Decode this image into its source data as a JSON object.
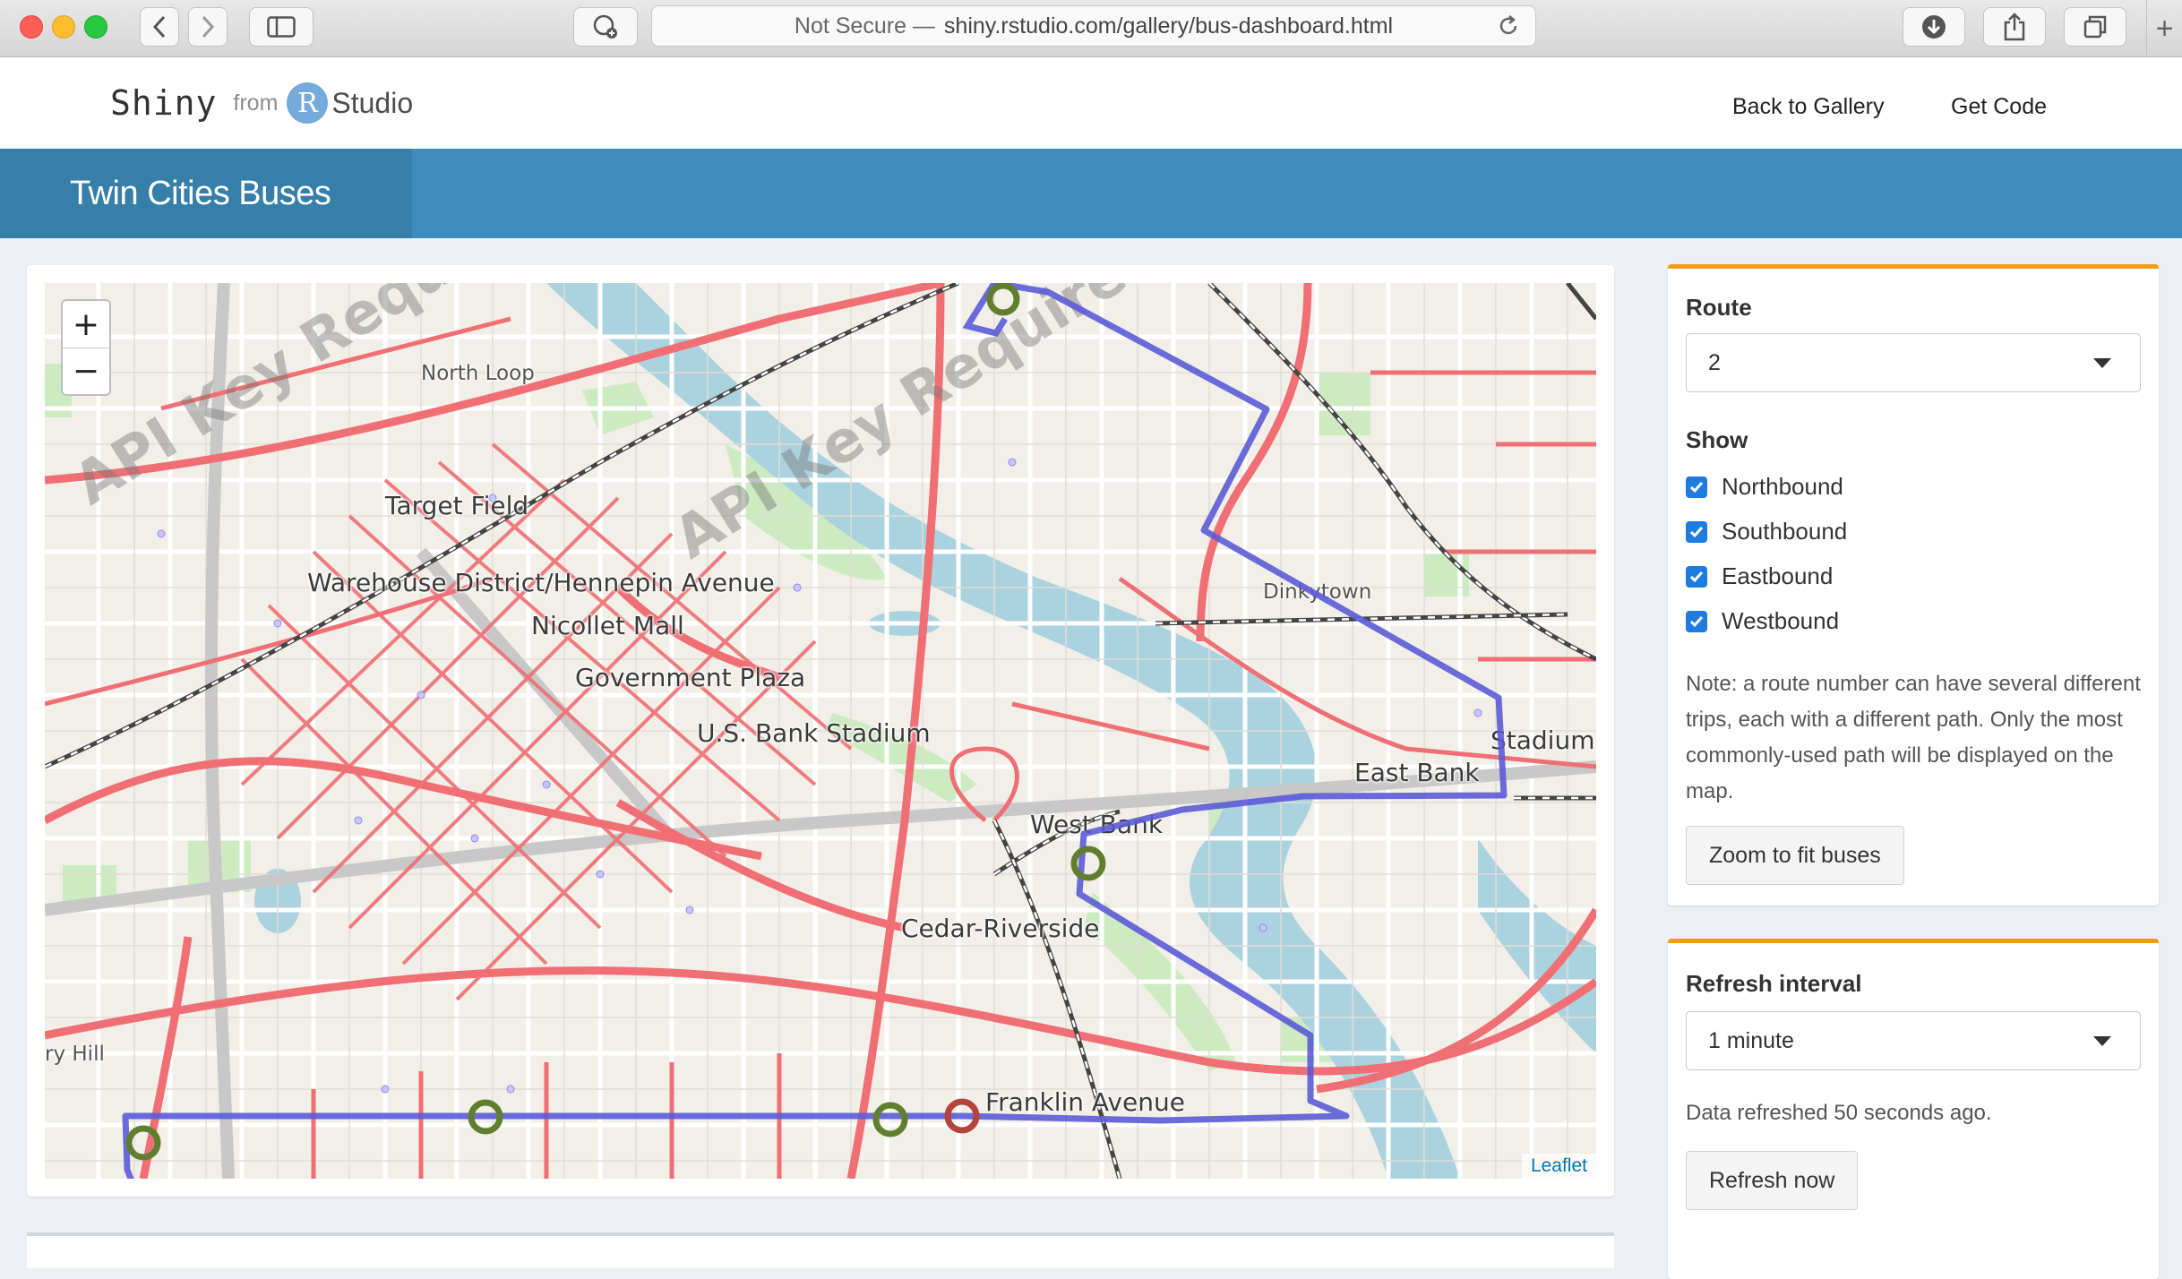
{
  "browser": {
    "security_label": "Not Secure —",
    "url": "shiny.rstudio.com/gallery/bus-dashboard.html",
    "new_tab_label": "+"
  },
  "header": {
    "brand_shiny": "Shiny",
    "brand_from": "from",
    "brand_r": "R",
    "brand_studio": "Studio",
    "nav": [
      "Back to Gallery",
      "Get Code"
    ]
  },
  "title": "Twin Cities Buses",
  "map": {
    "zoom_in": "+",
    "zoom_out": "−",
    "attribution": "Leaflet",
    "watermark": "API Key Required",
    "labels": {
      "north_loop": "North Loop",
      "target_field": "Target Field",
      "warehouse": "Warehouse District/Hennepin Avenue",
      "nicollet": "Nicollet Mall",
      "government": "Government Plaza",
      "stadium_usbank": "U.S. Bank Stadium",
      "dinkytown": "Dinkytown",
      "stadium": "Stadium",
      "east_bank": "East Bank",
      "west_bank": "West Bank",
      "cedar": "Cedar-Riverside",
      "franklin": "Franklin Avenue",
      "hill": "ry Hill"
    },
    "colors": {
      "route": "#5b5bd6",
      "streets": "#ef6f74",
      "water": "#aad3df",
      "park": "#cdebc0",
      "bus_green": "#5f7f2f",
      "bus_red": "#b3443e"
    }
  },
  "controls": {
    "route_label": "Route",
    "route_value": "2",
    "show_label": "Show",
    "directions": [
      "Northbound",
      "Southbound",
      "Eastbound",
      "Westbound"
    ],
    "note": "Note: a route number can have several different trips, each with a different path. Only the most commonly-used path will be displayed on the map.",
    "zoom_button": "Zoom to fit buses"
  },
  "refresh": {
    "label": "Refresh interval",
    "value": "1 minute",
    "status": "Data refreshed 50 seconds ago.",
    "button": "Refresh now"
  }
}
